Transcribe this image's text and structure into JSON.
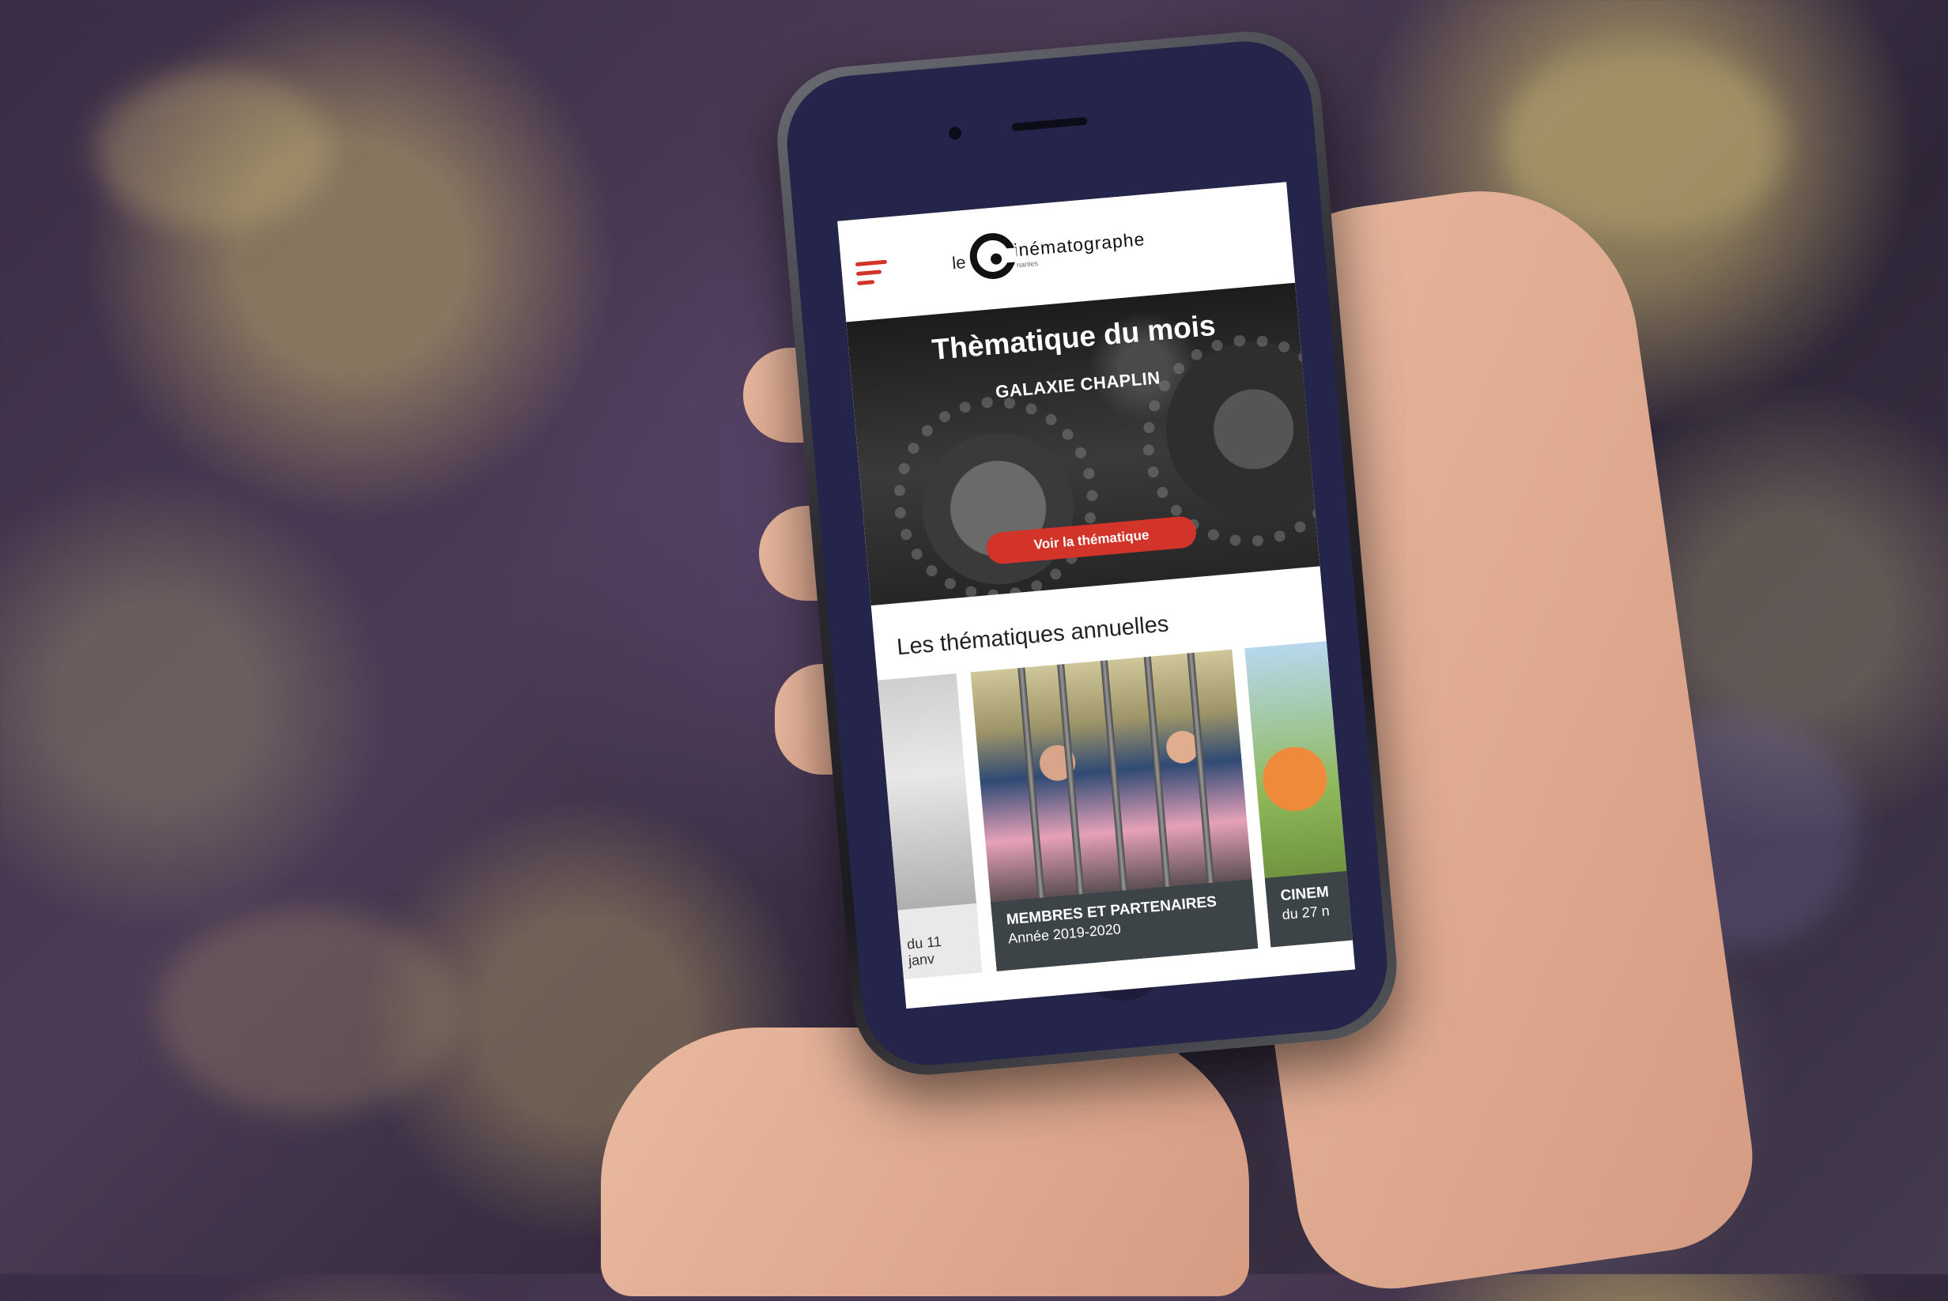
{
  "app": {
    "logo_prefix": "le",
    "logo_word": "inématographe",
    "logo_sub": "nantes"
  },
  "hero": {
    "title": "Thèmatique du mois",
    "subtitle": "GALAXIE CHAPLIN",
    "button_label": "Voir la thématique"
  },
  "annual": {
    "section_title": "Les thématiques annuelles",
    "cards": [
      {
        "title": "",
        "date": "du 11 janv"
      },
      {
        "title": "MEMBRES ET PARTENAIRES",
        "date": "Année 2019-2020"
      },
      {
        "title": "CINEM",
        "date": "du 27 n"
      }
    ]
  },
  "colors": {
    "accent": "#d2342a",
    "caption_bg": "#3d4448"
  },
  "icons": {
    "menu": "hamburger-icon"
  }
}
